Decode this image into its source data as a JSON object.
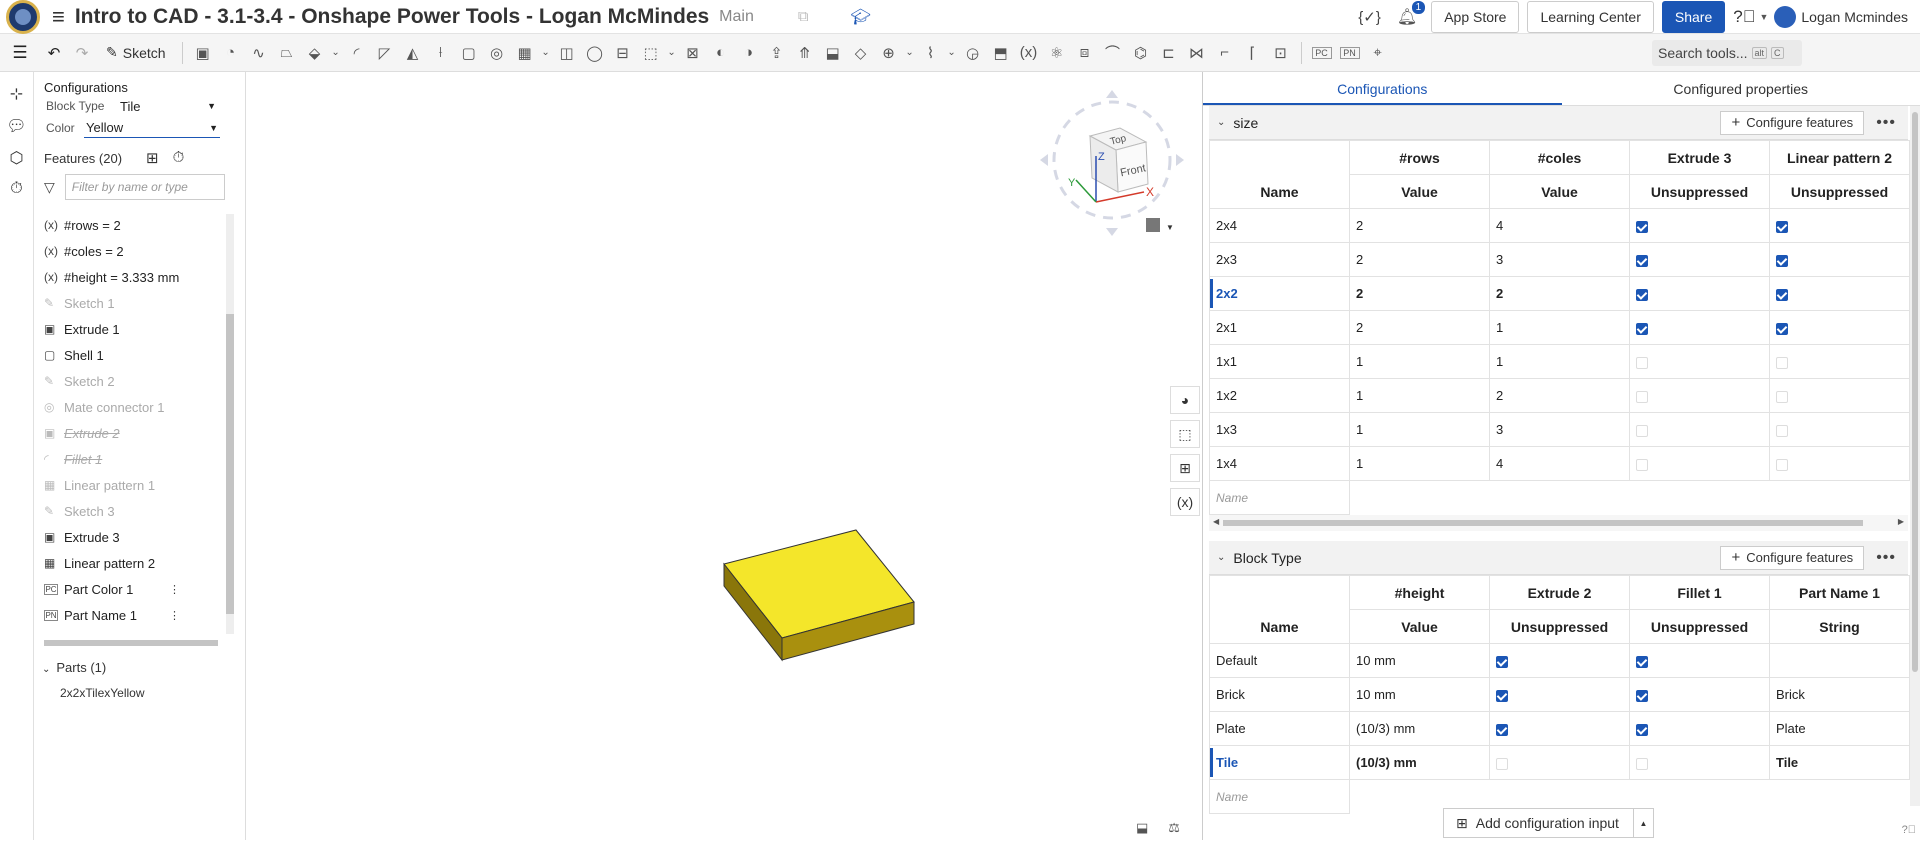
{
  "header": {
    "title": "Intro to CAD - 3.1-3.4 - Onshape Power Tools - Logan McMindes",
    "branch": "Main",
    "notification_count": "1",
    "variables_icon": "{✓}",
    "app_store": "App Store",
    "learning_center": "Learning Center",
    "share": "Share",
    "user_name": "Logan Mcmindes"
  },
  "toolbar": {
    "sketch_label": "Sketch",
    "search_placeholder": "Search tools...",
    "search_kbd_1": "alt",
    "search_kbd_2": "C"
  },
  "left_panel": {
    "configurations_title": "Configurations",
    "block_type_label": "Block Type",
    "block_type_value": "Tile",
    "color_label": "Color",
    "color_value": "Yellow",
    "features_title": "Features (20)",
    "filter_placeholder": "Filter by name or type",
    "features": [
      {
        "icon": "(x)",
        "name": "#rows = 2",
        "state": "normal"
      },
      {
        "icon": "(x)",
        "name": "#coles = 2",
        "state": "normal"
      },
      {
        "icon": "(x)",
        "name": "#height = 3.333 mm",
        "state": "normal"
      },
      {
        "icon": "✎",
        "name": "Sketch 1",
        "state": "dim"
      },
      {
        "icon": "▣",
        "name": "Extrude 1",
        "state": "normal"
      },
      {
        "icon": "▢",
        "name": "Shell 1",
        "state": "normal"
      },
      {
        "icon": "✎",
        "name": "Sketch 2",
        "state": "dim"
      },
      {
        "icon": "◎",
        "name": "Mate connector 1",
        "state": "dim"
      },
      {
        "icon": "▣",
        "name": "Extrude 2",
        "state": "suppressed"
      },
      {
        "icon": "◜",
        "name": "Fillet 1",
        "state": "suppressed"
      },
      {
        "icon": "▦",
        "name": "Linear pattern 1",
        "state": "dim"
      },
      {
        "icon": "✎",
        "name": "Sketch 3",
        "state": "dim"
      },
      {
        "icon": "▣",
        "name": "Extrude 3",
        "state": "normal"
      },
      {
        "icon": "▦",
        "name": "Linear pattern 2",
        "state": "normal"
      },
      {
        "icon": "PC",
        "name": "Part Color 1",
        "state": "normal",
        "dots": true
      },
      {
        "icon": "PN",
        "name": "Part Name 1",
        "state": "normal",
        "dots": true
      }
    ],
    "parts_title": "Parts (1)",
    "part_name": "2x2xTilexYellow"
  },
  "right_panel": {
    "tabs": [
      "Configurations",
      "Configured properties"
    ],
    "active_tab": 0,
    "configure_features": "Configure features",
    "name_placeholder": "Name",
    "add_configuration_input": "Add configuration input",
    "size": {
      "name": "size",
      "columns": [
        {
          "name": "#rows",
          "sub": "Value"
        },
        {
          "name": "#coles",
          "sub": "Value"
        },
        {
          "name": "Extrude 3",
          "sub": "Unsuppressed"
        },
        {
          "name": "Linear pattern 2",
          "sub": "Unsuppressed"
        }
      ],
      "name_header": "Name",
      "rows": [
        {
          "name": "2x4",
          "v1": "2",
          "v2": "4",
          "c1": true,
          "c2": true,
          "active": false
        },
        {
          "name": "2x3",
          "v1": "2",
          "v2": "3",
          "c1": true,
          "c2": true,
          "active": false
        },
        {
          "name": "2x2",
          "v1": "2",
          "v2": "2",
          "c1": true,
          "c2": true,
          "active": true
        },
        {
          "name": "2x1",
          "v1": "2",
          "v2": "1",
          "c1": true,
          "c2": true,
          "active": false
        },
        {
          "name": "1x1",
          "v1": "1",
          "v2": "1",
          "c1": false,
          "c2": false,
          "active": false
        },
        {
          "name": "1x2",
          "v1": "1",
          "v2": "2",
          "c1": false,
          "c2": false,
          "active": false
        },
        {
          "name": "1x3",
          "v1": "1",
          "v2": "3",
          "c1": false,
          "c2": false,
          "active": false
        },
        {
          "name": "1x4",
          "v1": "1",
          "v2": "4",
          "c1": false,
          "c2": false,
          "active": false
        }
      ]
    },
    "block_type": {
      "name": "Block Type",
      "name_header": "Name",
      "columns": [
        {
          "name": "#height",
          "sub": "Value"
        },
        {
          "name": "Extrude 2",
          "sub": "Unsuppressed"
        },
        {
          "name": "Fillet 1",
          "sub": "Unsuppressed"
        },
        {
          "name": "Part Name 1",
          "sub": "String"
        }
      ],
      "rows": [
        {
          "name": "Default",
          "h": "10 mm",
          "c1": true,
          "c2": true,
          "s": "",
          "active": false
        },
        {
          "name": "Brick",
          "h": "10 mm",
          "c1": true,
          "c2": true,
          "s": "Brick",
          "active": false
        },
        {
          "name": "Plate",
          "h": "(10/3) mm",
          "c1": true,
          "c2": true,
          "s": "Plate",
          "active": false
        },
        {
          "name": "Tile",
          "h": "(10/3) mm",
          "c1": false,
          "c2": false,
          "s": "Tile",
          "active": true
        }
      ]
    }
  },
  "viewcube": {
    "top": "Top",
    "front": "Front",
    "x": "X",
    "y": "Y",
    "z": "Z"
  },
  "colors": {
    "accent": "#1b56b5",
    "part_top": "#f0e020",
    "part_side": "#b59a10"
  }
}
